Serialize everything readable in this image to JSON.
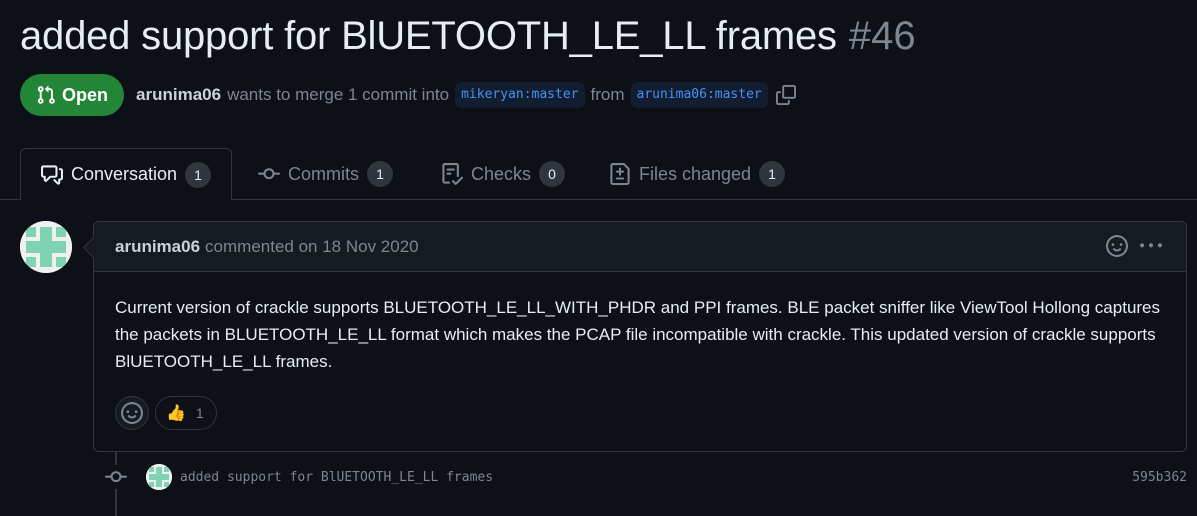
{
  "pr": {
    "title": "added support for BlUETOOTH_LE_LL frames",
    "number": "#46",
    "state": "Open",
    "author": "arunima06",
    "merge_text": "wants to merge 1 commit into",
    "base_branch": "mikeryan:master",
    "from_text": "from",
    "head_branch": "arunima06:master"
  },
  "tabs": [
    {
      "label": "Conversation",
      "count": "1",
      "icon": "comment-discussion-icon"
    },
    {
      "label": "Commits",
      "count": "1",
      "icon": "git-commit-icon"
    },
    {
      "label": "Checks",
      "count": "0",
      "icon": "checklist-icon"
    },
    {
      "label": "Files changed",
      "count": "1",
      "icon": "file-diff-icon"
    }
  ],
  "comment": {
    "author": "arunima06",
    "meta": "commented on 18 Nov 2020",
    "body": "Current version of crackle supports BLUETOOTH_LE_LL_WITH_PHDR and PPI frames. BLE packet sniffer like ViewTool Hollong captures the packets in BLUETOOTH_LE_LL format which makes the PCAP file incompatible with crackle. This updated version of crackle supports BlUETOOTH_LE_LL frames.",
    "reaction_emoji": "👍",
    "reaction_count": "1"
  },
  "commit": {
    "message": "added support for BlUETOOTH_LE_LL frames",
    "sha": "595b362"
  },
  "colors": {
    "background": "#0d1117",
    "open_badge": "#238636",
    "branch_text": "#4493f8",
    "muted": "#7d8590"
  }
}
